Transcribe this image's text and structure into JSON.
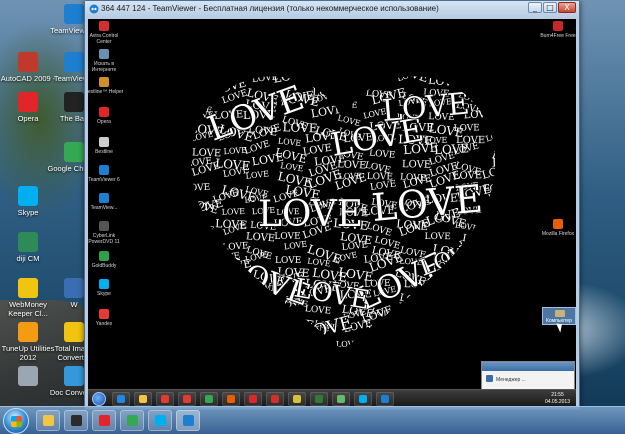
{
  "window": {
    "title": "364 447 124 - TeamViewer - Бесплатная лицензия (только некоммерческое использование)",
    "buttons": [
      "_",
      "□",
      "X"
    ]
  },
  "local_desktop_icons": [
    {
      "label": "TeamViewer 6",
      "icon": "teamviewer-icon",
      "color": "#1e7fd0"
    },
    {
      "label": "AutoCAD 2009 -",
      "icon": "autocad-icon",
      "color": "#c0392b"
    },
    {
      "label": "TeamView...",
      "icon": "teamviewer-icon",
      "color": "#1e7fd0"
    },
    {
      "label": "Opera",
      "icon": "opera-icon",
      "color": "#e0262b"
    },
    {
      "label": "The Bat!",
      "icon": "the-bat-icon",
      "color": "#222222"
    },
    {
      "label": "Google Chrome",
      "icon": "chrome-icon",
      "color": "#34a853"
    },
    {
      "label": "Skype",
      "icon": "skype-icon",
      "color": "#00aff0"
    },
    {
      "label": "diji CM",
      "icon": "diji-cm-icon",
      "color": "#2e8b57"
    },
    {
      "label": "WebMoney Keeper Cl...",
      "icon": "webmoney-icon",
      "color": "#f1c40f"
    },
    {
      "label": "W",
      "icon": "document-icon",
      "color": "#3b6db3"
    },
    {
      "label": "TuneUp Utilities 2012",
      "icon": "tuneup-icon",
      "color": "#f39c12"
    },
    {
      "label": "Total Image Converter",
      "icon": "image-converter-icon",
      "color": "#f1c40f"
    },
    {
      "label": "",
      "icon": "recycle-bin-icon",
      "color": "#9aa7b3"
    },
    {
      "label": "Doc Converter",
      "icon": "doc-converter-icon",
      "color": "#3498db"
    }
  ],
  "remote_left_icons": [
    {
      "label": "Avira Control Center",
      "icon": "avira-icon",
      "color": "#d32f2f"
    },
    {
      "label": "Искать в Интернете",
      "icon": "search-globe-icon",
      "color": "#6b8fb3"
    },
    {
      "label": "Bestline™ Helper",
      "icon": "bestline-icon",
      "color": "#d18f2c"
    },
    {
      "label": "Opera",
      "icon": "opera-icon",
      "color": "#e0262b"
    },
    {
      "label": "Bestline",
      "icon": "bestline-icon",
      "color": "#cccccc"
    },
    {
      "label": "TeamViewer 6",
      "icon": "teamviewer-icon",
      "color": "#1e7fd0"
    },
    {
      "label": "TeamView...",
      "icon": "teamviewer-icon",
      "color": "#1e7fd0"
    },
    {
      "label": "CyberLink PowerDVD 11",
      "icon": "powerdvd-icon",
      "color": "#555555"
    },
    {
      "label": "GoldBuddy",
      "icon": "goldbuddy-icon",
      "color": "#2e9e4f"
    },
    {
      "label": "Skype",
      "icon": "skype-icon",
      "color": "#00aff0"
    },
    {
      "label": "Yandex",
      "icon": "yandex-icon",
      "color": "#e53935"
    }
  ],
  "remote_right_icons": [
    {
      "label": "Burn4Free Free",
      "icon": "burn4free-icon",
      "color": "#c62828"
    },
    {
      "label": "Mozilla Firefox",
      "icon": "firefox-icon",
      "color": "#e66000"
    }
  ],
  "heart_words": [
    "LOVE"
  ],
  "remote_popup": {
    "text": "Менеджер ..."
  },
  "remote_computer_icon": {
    "label": "Компьютер"
  },
  "remote_clock": {
    "time": "21:55",
    "date": "04.05.2013"
  },
  "remote_taskbar_items": [
    {
      "icon": "start-orb",
      "color": ""
    },
    {
      "icon": "ie-icon",
      "color": "#1e88e5"
    },
    {
      "icon": "explorer-icon",
      "color": "#f4c542"
    },
    {
      "icon": "media-icon",
      "color": "#e53935"
    },
    {
      "icon": "yandex-icon",
      "color": "#e53935"
    },
    {
      "icon": "chrome-icon",
      "color": "#34a853"
    },
    {
      "icon": "firefox-icon",
      "color": "#e66000"
    },
    {
      "icon": "opera-icon",
      "color": "#e0262b"
    },
    {
      "icon": "avira-icon",
      "color": "#d32f2f"
    },
    {
      "icon": "the-bat-icon",
      "color": "#d4c23a"
    },
    {
      "icon": "teamviewer-icon",
      "color": "#2e7d32"
    },
    {
      "icon": "utorrent-icon",
      "color": "#66bb6a"
    },
    {
      "icon": "skype-icon",
      "color": "#00aff0"
    },
    {
      "icon": "teamviewer-icon",
      "color": "#1e7fd0"
    }
  ],
  "local_taskbar_items": [
    {
      "icon": "explorer-icon",
      "color": "#f4c542"
    },
    {
      "icon": "media-player-icon",
      "color": "#2b2b2b"
    },
    {
      "icon": "opera-icon",
      "color": "#e0262b"
    },
    {
      "icon": "chrome-icon",
      "color": "#34a853"
    },
    {
      "icon": "skype-icon",
      "color": "#00aff0"
    },
    {
      "icon": "teamviewer-icon",
      "color": "#1e7fd0"
    }
  ]
}
